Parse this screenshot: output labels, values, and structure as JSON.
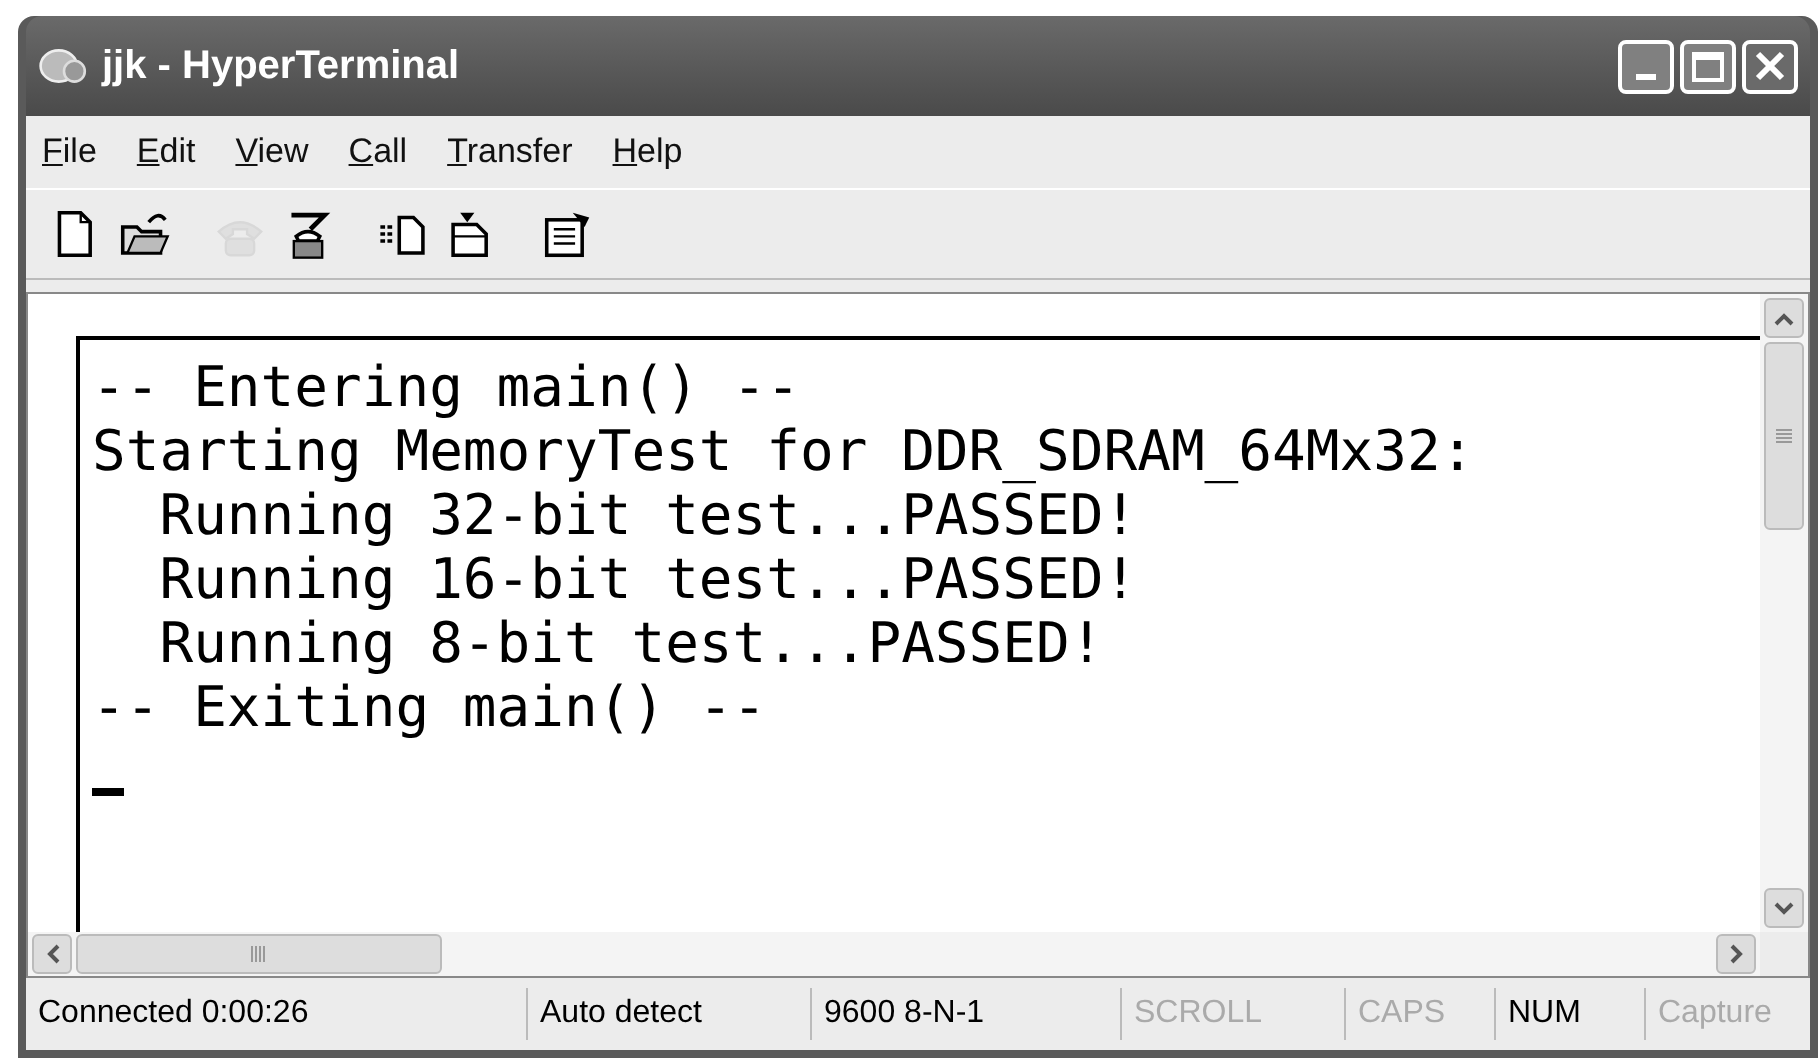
{
  "window": {
    "title": "jjk - HyperTerminal"
  },
  "menu": [
    "File",
    "Edit",
    "View",
    "Call",
    "Transfer",
    "Help"
  ],
  "toolbar": [
    {
      "kind": "new",
      "disabled": false
    },
    {
      "kind": "open",
      "disabled": false
    },
    {
      "kind": "disconnect",
      "disabled": true
    },
    {
      "kind": "dial",
      "disabled": false
    },
    {
      "kind": "send",
      "disabled": false
    },
    {
      "kind": "receive",
      "disabled": false
    },
    {
      "kind": "properties",
      "disabled": false
    }
  ],
  "terminal": {
    "lines": [
      "-- Entering main() --",
      "Starting MemoryTest for DDR_SDRAM_64Mx32:",
      "  Running 32-bit test...PASSED!",
      "  Running 16-bit test...PASSED!",
      "  Running 8-bit test...PASSED!",
      "-- Exiting main() --"
    ]
  },
  "status_bar": [
    {
      "text": "Connected 0:00:26",
      "disabled": false
    },
    {
      "text": "Auto detect",
      "disabled": false
    },
    {
      "text": "9600 8-N-1",
      "disabled": false
    },
    {
      "text": "SCROLL",
      "disabled": true
    },
    {
      "text": "CAPS",
      "disabled": true
    },
    {
      "text": "NUM",
      "disabled": false
    },
    {
      "text": "Capture",
      "disabled": true
    }
  ]
}
